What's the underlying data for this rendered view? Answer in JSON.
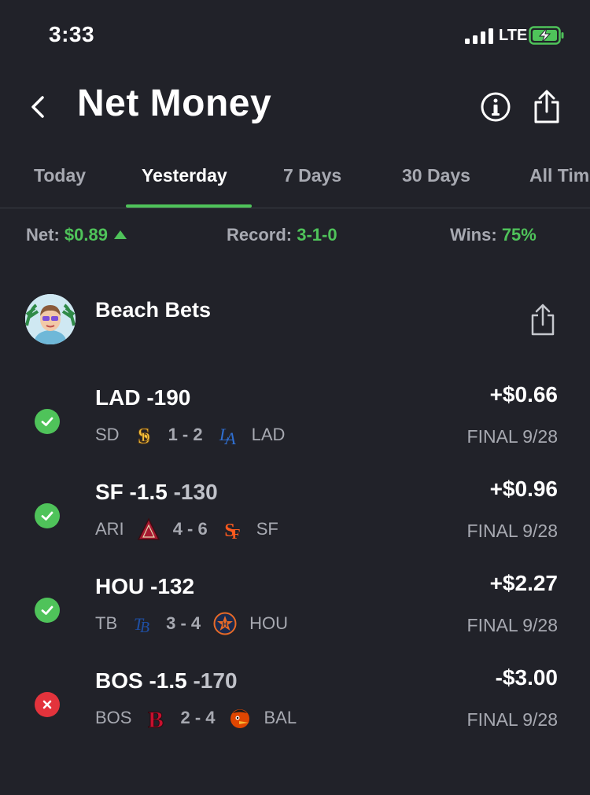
{
  "status_bar": {
    "time": "3:33",
    "network": "LTE",
    "battery_icon": "battery-charging-icon"
  },
  "header": {
    "title": "Net Money",
    "back_icon": "chevron-left-icon",
    "info_icon": "info-icon",
    "share_icon": "share-icon"
  },
  "tabs": [
    {
      "label": "Today",
      "active": false
    },
    {
      "label": "Yesterday",
      "active": true
    },
    {
      "label": "7 Days",
      "active": false
    },
    {
      "label": "30 Days",
      "active": false
    },
    {
      "label": "All Time",
      "active": false
    }
  ],
  "stats": {
    "net_label": "Net:",
    "net_value": "$0.89",
    "record_label": "Record:",
    "record_value": "3-1-0",
    "wins_label": "Wins:",
    "wins_value": "75%"
  },
  "group": {
    "name": "Beach Bets"
  },
  "bets": [
    {
      "result": "win",
      "pick_team": "LAD -190",
      "pick_odds": "",
      "away": "SD",
      "score": "1 - 2",
      "home": "LAD",
      "amount": "+$0.66",
      "final": "FINAL 9/28"
    },
    {
      "result": "win",
      "pick_team": "SF -1.5",
      "pick_odds": "-130",
      "away": "ARI",
      "score": "4 - 6",
      "home": "SF",
      "amount": "+$0.96",
      "final": "FINAL 9/28"
    },
    {
      "result": "win",
      "pick_team": "HOU -132",
      "pick_odds": "",
      "away": "TB",
      "score": "3 - 4",
      "home": "HOU",
      "amount": "+$2.27",
      "final": "FINAL 9/28"
    },
    {
      "result": "loss",
      "pick_team": "BOS -1.5",
      "pick_odds": "-170",
      "away": "BOS",
      "score": "2 - 4",
      "home": "BAL",
      "amount": "-$3.00",
      "final": "FINAL 9/28"
    }
  ],
  "colors": {
    "background": "#212229",
    "accent_green": "#4fc35a",
    "loss_red": "#e3333c",
    "muted": "#a7a9b1"
  }
}
